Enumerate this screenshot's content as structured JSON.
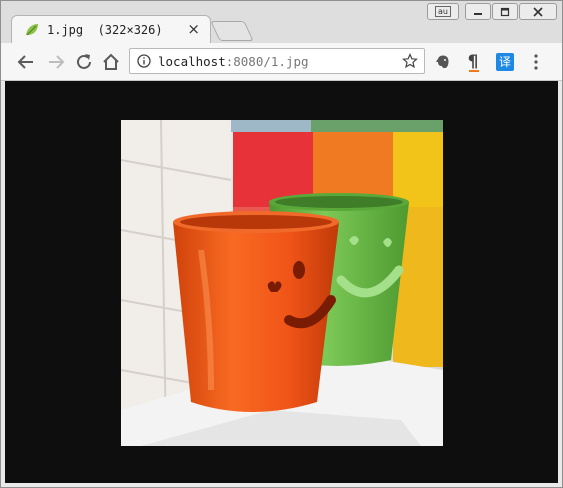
{
  "tab": {
    "title": "1.jpg  (322×326)",
    "close": "×",
    "favicon": "leaf-icon"
  },
  "window_controls": {
    "user_badge": "au",
    "minimize": "minimize-icon",
    "maximize": "maximize-icon",
    "close": "close-icon"
  },
  "toolbar": {
    "back": "back-arrow-icon",
    "forward": "forward-arrow-icon",
    "reload": "reload-icon",
    "home": "home-icon"
  },
  "omnibox": {
    "host": "localhost",
    "path": ":8080/1.jpg",
    "info_icon": "info-icon",
    "star_icon": "star-icon"
  },
  "extensions": {
    "ext1": "evernote-elephant-icon",
    "ext2": "pilcrow-icon",
    "ext2_label": "¶",
    "translate_label": "译",
    "menu": "menu-kebab-icon"
  },
  "colors": {
    "viewport_bg": "#0e0e0e",
    "cup_orange": "#f05a1a",
    "cup_green": "#6fbf4a",
    "translate_blue": "#1e88e5"
  },
  "image": {
    "alt": "1.jpg",
    "dimensions": "322×326"
  }
}
